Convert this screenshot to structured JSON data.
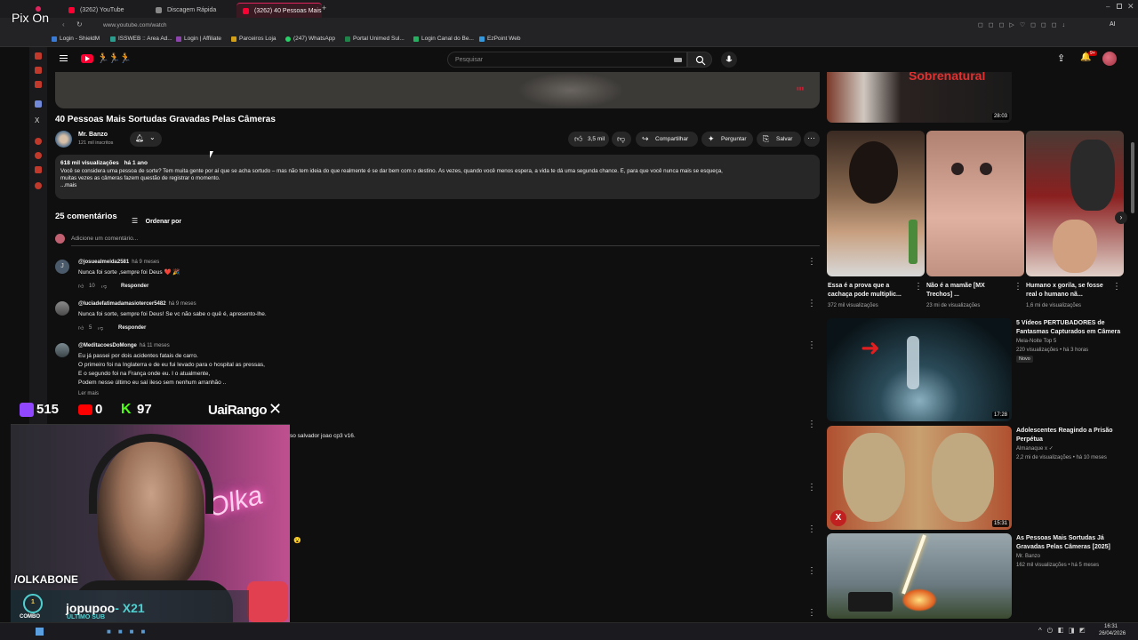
{
  "browser": {
    "tabs": [
      {
        "label": "(3262) YouTube",
        "favicon_color": "#ff0033"
      },
      {
        "label": "Discagem Rápida",
        "favicon_color": "#888888"
      },
      {
        "label": "(3262) 40 Pessoas Mais",
        "favicon_color": "#ff0033"
      }
    ],
    "new_tab_glyph": "+",
    "url": "www.youtube.com/watch",
    "ai_label": "AI",
    "bookmarks": [
      {
        "label": "Login - ShieldM",
        "color": "#3a7bd5"
      },
      {
        "label": "ISSWEB :: Area Ad...",
        "color": "#2a9d8f"
      },
      {
        "label": "Login | Affiliate",
        "color": "#8e44ad"
      },
      {
        "label": "Parceiros Loja",
        "color": "#d4a017"
      },
      {
        "label": "(247) WhatsApp",
        "color": "#25d366"
      },
      {
        "label": "Portal Unimed Sul...",
        "color": "#1e8449"
      },
      {
        "label": "Login Canal do Be...",
        "color": "#27ae60"
      },
      {
        "label": "EzPoint Web",
        "color": "#3498db"
      }
    ]
  },
  "youtube": {
    "search_placeholder": "Pesquisar",
    "notif_badge": "9+",
    "video": {
      "title": "40 Pessoas Mais Sortudas Gravadas Pelas Câmeras",
      "channel": "Mr. Banzo",
      "subscribers": "121 mil inscritos",
      "likes": "3,5 mil",
      "share_label": "Compartilhar",
      "ask_label": "Perguntar",
      "save_label": "Salvar",
      "views": "618 mil visualizações",
      "age": "há 1 ano",
      "description_line1": "Você se considera uma pessoa de sorte? Tem muita gente por aí que se acha sortudo – mas não tem ideia do que realmente é se dar bem com o destino. Às vezes, quando você menos espera, a vida te dá uma segunda chance. E, para que você nunca mais se esqueça,",
      "description_line2": "muitas vezes as câmeras fazem questão de registrar o momento.",
      "more_label": "...mais"
    },
    "comments_header": {
      "count_label": "25 comentários",
      "sort_label": "Ordenar por",
      "add_placeholder": "Adicione um comentário..."
    },
    "comments": [
      {
        "user": "@josuealmeida2581",
        "time": "há 9 meses",
        "lines": [
          "Nunca foi sorte ,sempre foi Deus ❤️ 🎉"
        ],
        "likes": "10",
        "reply": "Responder",
        "avatar_color": "#4a5a6a",
        "avatar_letter": "J"
      },
      {
        "user": "@luciadefatimadamasiotercer5482",
        "time": "há 9 meses",
        "lines": [
          "Nunca foi sorte, sempre foi Deus! Se vc não sabe o quê é, apresento-lhe."
        ],
        "likes": "5",
        "reply": "Responder",
        "avatar_color": "#6b6b6b",
        "avatar_letter": ""
      },
      {
        "user": "@MeditacoesDoMonge",
        "time": "há 11 meses",
        "lines": [
          "Eu já passei por dois acidentes fatais de carro.",
          "O primeiro foi na Inglaterra e de eu fui levado para o hospital as pressas,",
          "E o segundo foi na França onde eu. I o atualmente,",
          "Podem nesse último eu saí ileso sem nenhum arranhão .."
        ],
        "read_more": "Ler mais",
        "avatar_color": "#556066",
        "avatar_letter": ""
      }
    ],
    "partial_comment_text": "so salvador joao cp3 v16.",
    "related_top_duration": "28:03",
    "shorts": [
      {
        "title": "Essa é a prova que a cachaça pode multiplic...",
        "views": "372 mil visualizações",
        "colors": [
          "#3a2a22",
          "#c8a080"
        ]
      },
      {
        "title": "Não é a mamãe [MX Trechos] ...",
        "views": "23 mi de visualizações",
        "colors": [
          "#c09080",
          "#e0b0a0"
        ]
      },
      {
        "title": "Humano x gorila, se fosse real o humano nã...",
        "views": "1,6 mi de visualizações",
        "colors": [
          "#5a3a30",
          "#e0d0c8"
        ]
      }
    ],
    "related": [
      {
        "title": "5 Vídeos PERTUBADORES de Fantasmas Capturados em Câmera",
        "channel": "Meia-Noite Top 5",
        "meta": "220 visualizações • há 3 horas",
        "badge": "Novo",
        "duration": "17:28",
        "bg": "#1a2a30"
      },
      {
        "title": "Adolescentes Reagindo a Prisão Perpétua",
        "channel": "Almanaque x ✓",
        "meta": "2,2 mi de visualizações • há 10 meses",
        "badge": "",
        "duration": "15:31",
        "bg": "#b05030"
      },
      {
        "title": "As Pessoas Mais Sortudas Já Gravadas Pelas Câmeras [2025]",
        "channel": "Mr. Banzo",
        "meta": "162 mil visualizações • há 5 meses",
        "badge": "",
        "duration": "",
        "bg": "#7a8a90"
      }
    ]
  },
  "stream_overlay": {
    "pix_label": "Pix On",
    "twitch_count": "515",
    "youtube_count": "0",
    "kick_count": "97",
    "sponsor": "UaiRango",
    "streamer_handle": "/OLKABONE",
    "combo_count": "1",
    "combo_label": "COMBO",
    "last_sub_name": "jopupoo",
    "last_sub_mult": "- X21",
    "last_sub_label": "ÚLTIMO SUB",
    "neon_text": "Olka"
  },
  "taskbar": {
    "time": "16:31",
    "date": "26/04/2026"
  }
}
